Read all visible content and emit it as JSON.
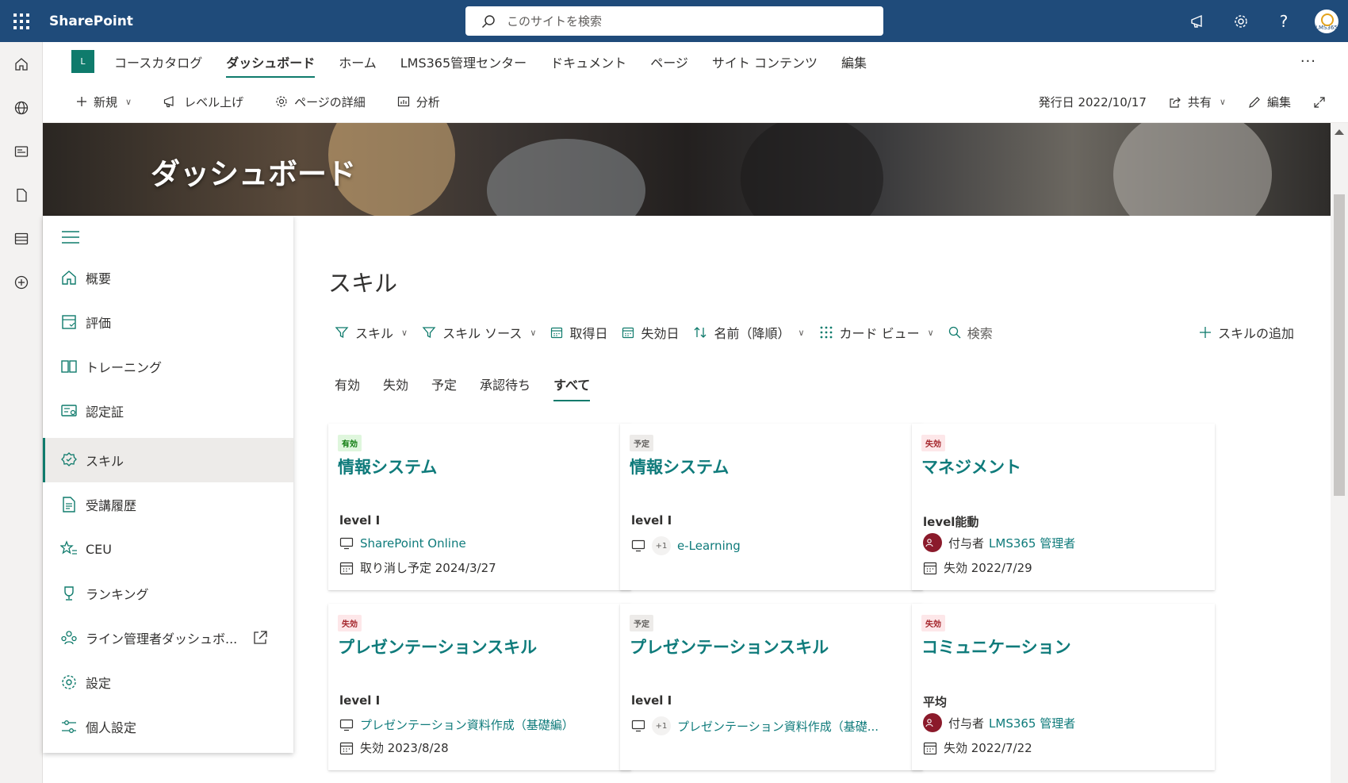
{
  "suite": {
    "brand": "SharePoint",
    "search_placeholder": "このサイトを検索",
    "avatar_label": "LMS365"
  },
  "hubnav": {
    "logo_letter": "L",
    "items": [
      "コースカタログ",
      "ダッシュボード",
      "ホーム",
      "LMS365管理センター",
      "ドキュメント",
      "ページ",
      "サイト コンテンツ",
      "編集"
    ],
    "more": "···"
  },
  "cmdbar": {
    "new": "新規",
    "promote": "レベル上げ",
    "page_details": "ページの詳細",
    "analytics": "分析",
    "published": "発行日 2022/10/17",
    "share": "共有",
    "edit": "編集"
  },
  "hero": {
    "title": "ダッシュボード"
  },
  "leftnav": {
    "items": [
      "概要",
      "評価",
      "トレーニング",
      "認定証",
      "スキル",
      "受講履歴",
      "CEU",
      "ランキング",
      "ライン管理者ダッシュボ...",
      "設定",
      "個人設定"
    ]
  },
  "main": {
    "title": "スキル",
    "filters": {
      "skill": "スキル",
      "skill_source": "スキル ソース",
      "acquired": "取得日",
      "expires": "失効日",
      "sort": "名前（降順）",
      "view": "カード ビュー",
      "search": "検索",
      "add": "スキルの追加"
    },
    "tabs": [
      "有効",
      "失効",
      "予定",
      "承認待ち",
      "すべて"
    ]
  },
  "cards": [
    {
      "badge": "有効",
      "title": "情報システム",
      "level": "level I",
      "row1": "SharePoint Online",
      "row2": "取り消し予定 2024/3/27"
    },
    {
      "badge": "予定",
      "title": "情報システム",
      "level": "level I",
      "plus": "+1",
      "row1": "e-Learning"
    },
    {
      "badge": "失効",
      "title": "マネジメント",
      "level": "level能動",
      "row1_prefix": "付与者",
      "row1": "LMS365 管理者",
      "row2": "失効 2022/7/29"
    },
    {
      "badge": "失効",
      "title": "プレゼンテーションスキル",
      "level": "level I",
      "row1": "プレゼンテーション資料作成（基礎編）",
      "row2": "失効 2023/8/28"
    },
    {
      "badge": "予定",
      "title": "プレゼンテーションスキル",
      "level": "level I",
      "plus": "+1",
      "row1": "プレゼンテーション資料作成（基礎..."
    },
    {
      "badge": "失効",
      "title": "コミュニケーション",
      "level": "平均",
      "row1_prefix": "付与者",
      "row1": "LMS365 管理者",
      "row2": "失効 2022/7/22"
    }
  ],
  "colors": {
    "suitebar": "#1f4b7a",
    "accent": "#0f7b6c",
    "link": "#0f7b7b"
  }
}
